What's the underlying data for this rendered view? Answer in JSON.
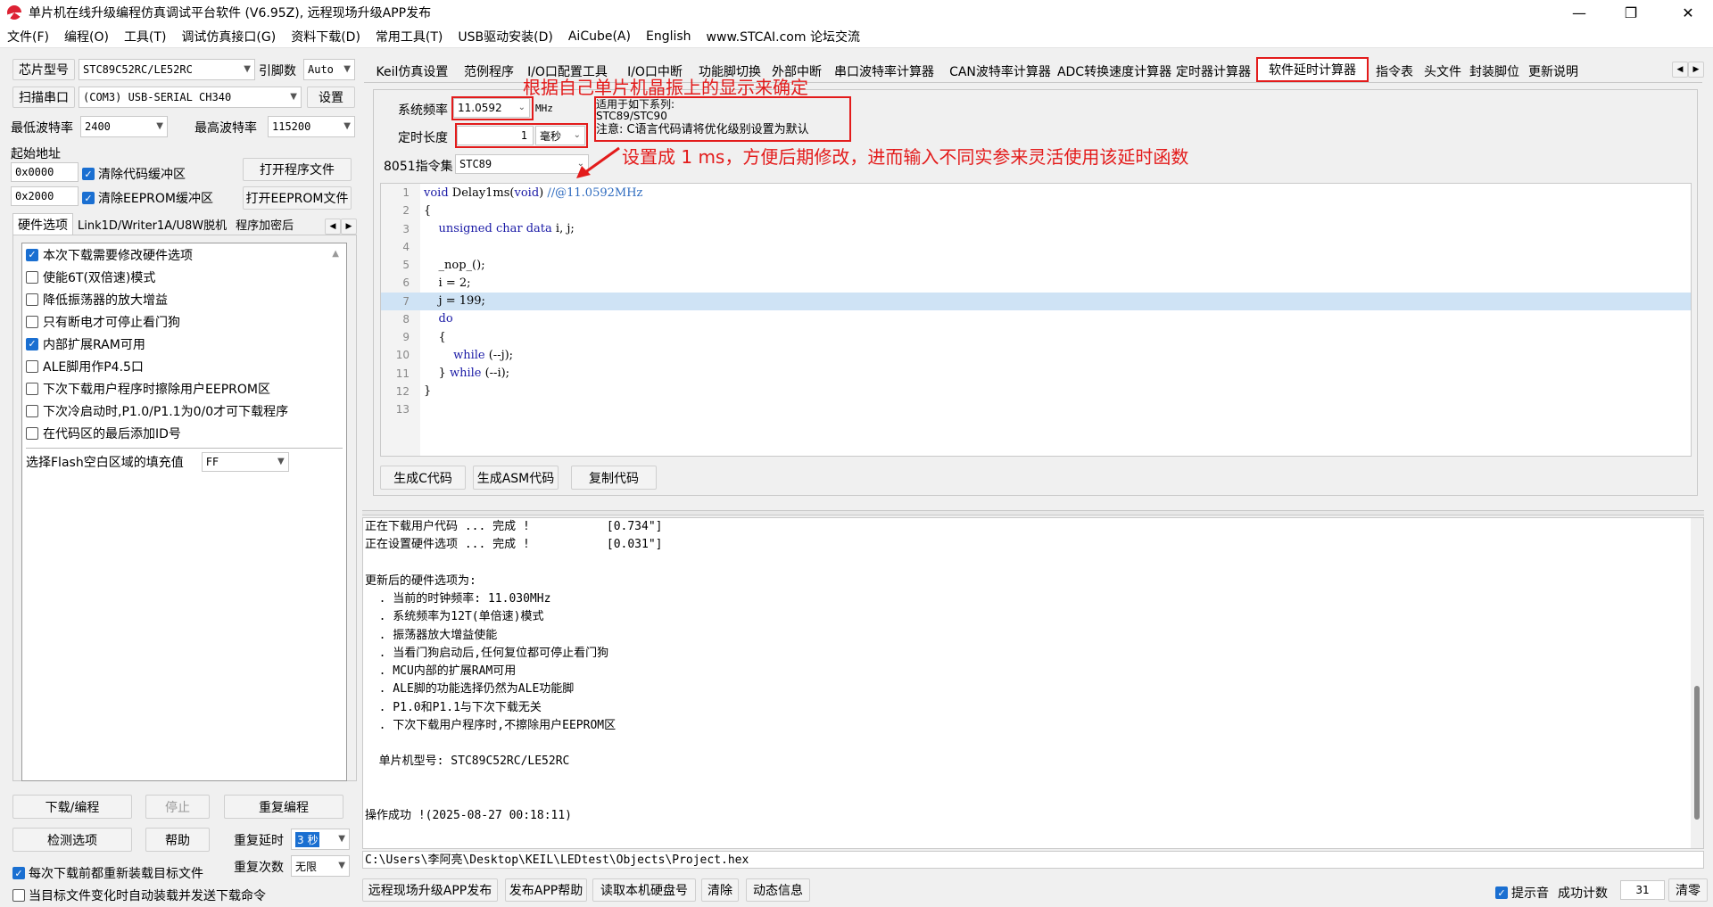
{
  "window": {
    "title": "单片机在线升级编程仿真调试平台软件 (V6.95Z), 远程现场升级APP发布",
    "minimize": "—",
    "maximize": "❐",
    "close": "✕"
  },
  "menu": [
    "文件(F)",
    "编程(O)",
    "工具(T)",
    "调试仿真接口(G)",
    "资料下载(D)",
    "常用工具(T)",
    "USB驱动安装(D)",
    "AiCube(A)",
    "English",
    "www.STCAI.com 论坛交流"
  ],
  "left": {
    "chip_label": "芯片型号",
    "chip_value": "STC89C52RC/LE52RC",
    "pins_label": "引脚数",
    "pins_value": "Auto",
    "scan_port": "扫描串口",
    "port_value": "(COM3) USB-SERIAL CH340",
    "settings": "设置",
    "min_baud_label": "最低波特率",
    "min_baud": "2400",
    "max_baud_label": "最高波特率",
    "max_baud": "115200",
    "start_addr_label": "起始地址",
    "addr1": "0x0000",
    "clear_code": "清除代码缓冲区",
    "open_prog": "打开程序文件",
    "addr2": "0x2000",
    "clear_eeprom": "清除EEPROM缓冲区",
    "open_eeprom": "打开EEPROM文件",
    "tabs": [
      "硬件选项",
      "Link1D/Writer1A/U8W脱机",
      "程序加密后"
    ],
    "options": [
      {
        "label": "本次下载需要修改硬件选项",
        "checked": true
      },
      {
        "label": "使能6T(双倍速)模式",
        "checked": false
      },
      {
        "label": "降低振荡器的放大增益",
        "checked": false
      },
      {
        "label": "只有断电才可停止看门狗",
        "checked": false
      },
      {
        "label": "内部扩展RAM可用",
        "checked": true
      },
      {
        "label": "ALE脚用作P4.5口",
        "checked": false
      },
      {
        "label": "下次下载用户程序时擦除用户EEPROM区",
        "checked": false
      },
      {
        "label": "下次冷启动时,P1.0/P1.1为0/0才可下载程序",
        "checked": false
      },
      {
        "label": "在代码区的最后添加ID号",
        "checked": false
      }
    ],
    "flash_fill_label": "选择Flash空白区域的填充值",
    "flash_fill": "FF",
    "download": "下载/编程",
    "stop": "停止",
    "reprogram": "重复编程",
    "check_opts": "检测选项",
    "help": "帮助",
    "repeat_delay_label": "重复延时",
    "repeat_delay": "3 秒",
    "repeat_count_label": "重复次数",
    "repeat_count": "无限",
    "reload_before": "每次下载前都重新装载目标文件",
    "auto_load": "当目标文件变化时自动装载并发送下载命令"
  },
  "tabs": [
    "Keil仿真设置",
    "范例程序",
    "I/O口配置工具",
    "I/O口中断",
    "功能脚切换",
    "外部中断",
    "串口波特率计算器",
    "CAN波特率计算器",
    "ADC转换速度计算器",
    "定时器计算器",
    "软件延时计算器",
    "指令表",
    "头文件",
    "封装脚位",
    "更新说明"
  ],
  "delay": {
    "sysfreq_label": "系统频率",
    "sysfreq": "11.0592",
    "mhz": "MHz",
    "length_label": "定时长度",
    "length": "1",
    "unit": "毫秒",
    "iset_label": "8051指令集",
    "iset": "STC89",
    "applies_title": "适用于如下系列:",
    "applies_series": "STC89/STC90",
    "note": "注意: C语言代码请将优化级别设置为默认",
    "gen_c": "生成C代码",
    "gen_asm": "生成ASM代码",
    "copy": "复制代码"
  },
  "code": [
    "void Delay1ms(void) //@11.0592MHz",
    "{",
    "    unsigned char data i, j;",
    "",
    "    _nop_();",
    "    i = 2;",
    "    j = 199;",
    "    do",
    "    {",
    "        while (--j);",
    "    } while (--i);",
    "}",
    ""
  ],
  "annotations": {
    "top": "根据自己单片机晶振上的显示来确定",
    "right": "设置成 1 ms，方便后期修改，进而输入不同实参来灵活使用该延时函数"
  },
  "log": [
    "正在下载用户代码 ... 完成 !           [0.734\"]",
    "正在设置硬件选项 ... 完成 !           [0.031\"]",
    "",
    "更新后的硬件选项为:",
    "  . 当前的时钟频率: 11.030MHz",
    "  . 系统频率为12T(单倍速)模式",
    "  . 振荡器放大增益使能",
    "  . 当看门狗启动后,任何复位都可停止看门狗",
    "  . MCU内部的扩展RAM可用",
    "  . ALE脚的功能选择仍然为ALE功能脚",
    "  . P1.0和P1.1与下次下载无关",
    "  . 下次下载用户程序时,不擦除用户EEPROM区",
    "",
    "  单片机型号: STC89C52RC/LE52RC",
    "",
    "",
    "操作成功 !(2025-08-27 00:18:11)"
  ],
  "filepath": "C:\\Users\\李阿亮\\Desktop\\KEIL\\LEDtest\\Objects\\Project.hex",
  "bottom": {
    "btns": [
      "远程现场升级APP发布",
      "发布APP帮助",
      "读取本机硬盘号",
      "清除",
      "动态信息"
    ],
    "sound": "提示音",
    "count_label": "成功计数",
    "count": "31",
    "reset": "清零"
  },
  "colors": {
    "accent": "#1a6fd1",
    "annotation": "#e31b1b",
    "highlight": "#cfe3f5"
  }
}
